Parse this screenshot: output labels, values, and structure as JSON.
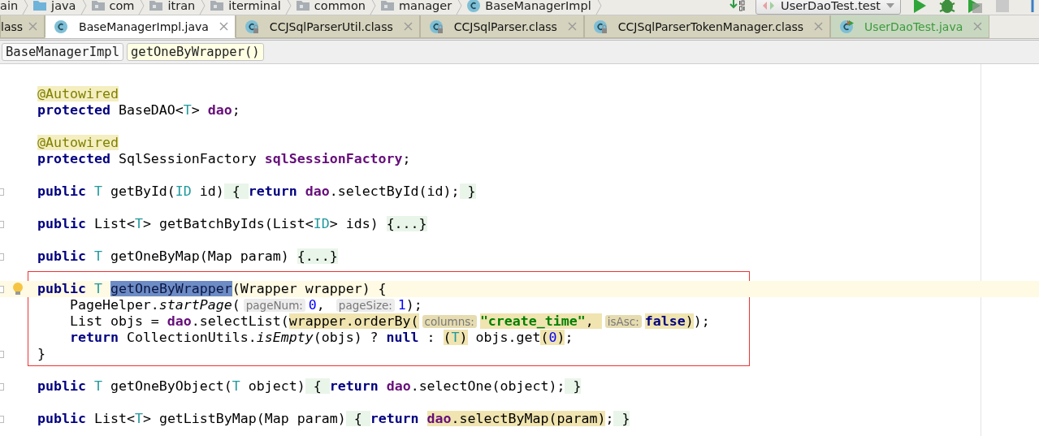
{
  "breadcrumbs": [
    {
      "label": "ain"
    },
    {
      "label": "java"
    },
    {
      "label": "com"
    },
    {
      "label": "itran"
    },
    {
      "label": "iterminal"
    },
    {
      "label": "common"
    },
    {
      "label": "manager"
    },
    {
      "label": "BaseManagerImpl"
    }
  ],
  "toolbar": {
    "run_config": "UserDaoTest.test"
  },
  "tabs": [
    {
      "label": "lass",
      "kind": "normal",
      "selected": false
    },
    {
      "label": "BaseManagerImpl.java",
      "kind": "normal",
      "selected": true
    },
    {
      "label": "CCJSqlParserUtil.class",
      "kind": "normal",
      "selected": false
    },
    {
      "label": "CCJSqlParser.class",
      "kind": "normal",
      "selected": false
    },
    {
      "label": "CCJSqlParserTokenManager.class",
      "kind": "normal",
      "selected": false
    },
    {
      "label": "UserDaoTest.java",
      "kind": "test",
      "selected": false
    }
  ],
  "structure": [
    {
      "label": "BaseManagerImpl",
      "selected": false
    },
    {
      "label": "getOneByWrapper()",
      "selected": true
    }
  ],
  "editor": {
    "blocks": [
      {
        "framed": false,
        "lines": [
          {
            "fold": false,
            "current": false,
            "intention": false,
            "tokens": [
              {
                "text": "@Autowired",
                "kind": "annotation"
              }
            ]
          },
          {
            "fold": false,
            "current": false,
            "intention": false,
            "tokens": [
              {
                "text": "protected",
                "kind": "keyword"
              },
              {
                "text": " BaseDAO<",
                "kind": "plain"
              },
              {
                "text": "T",
                "kind": "typeparam"
              },
              {
                "text": "> ",
                "kind": "plain"
              },
              {
                "text": "dao",
                "kind": "field"
              },
              {
                "text": ";",
                "kind": "plain"
              }
            ]
          },
          {
            "fold": false,
            "current": false,
            "intention": false
          },
          {
            "fold": false,
            "current": false,
            "intention": false,
            "tokens": [
              {
                "text": "@Autowired",
                "kind": "annotation"
              }
            ]
          },
          {
            "fold": false,
            "current": false,
            "intention": false,
            "tokens": [
              {
                "text": "protected",
                "kind": "keyword"
              },
              {
                "text": " SqlSessionFactory ",
                "kind": "plain"
              },
              {
                "text": "sqlSessionFactory",
                "kind": "field"
              },
              {
                "text": ";",
                "kind": "plain"
              }
            ]
          },
          {
            "fold": false,
            "current": false,
            "intention": false
          },
          {
            "fold": true,
            "current": false,
            "intention": false,
            "tokens": [
              {
                "text": "public",
                "kind": "keyword"
              },
              {
                "text": " T",
                "kind": "typeparam"
              },
              {
                "text": " getById(",
                "kind": "plain"
              },
              {
                "text": "ID",
                "kind": "typeparam"
              },
              {
                "text": " id)",
                "kind": "plain"
              },
              {
                "text": " { ",
                "kind": "fold"
              },
              {
                "text": "return",
                "kind": "keyword"
              },
              {
                "text": " dao",
                "kind": "field"
              },
              {
                "text": ".selectById(id);",
                "kind": "plain"
              },
              {
                "text": " }",
                "kind": "fold"
              }
            ]
          },
          {
            "fold": false,
            "current": false,
            "intention": false
          },
          {
            "fold": true,
            "current": false,
            "intention": false,
            "tokens": [
              {
                "text": "public",
                "kind": "keyword"
              },
              {
                "text": " List<",
                "kind": "plain"
              },
              {
                "text": "T",
                "kind": "typeparam"
              },
              {
                "text": "> getBatchByIds(List<",
                "kind": "plain"
              },
              {
                "text": "ID",
                "kind": "typeparam"
              },
              {
                "text": "> ids) ",
                "kind": "plain"
              },
              {
                "text": "{...}",
                "kind": "fold"
              }
            ]
          },
          {
            "fold": false,
            "current": false,
            "intention": false
          },
          {
            "fold": true,
            "current": false,
            "intention": false,
            "tokens": [
              {
                "text": "public",
                "kind": "keyword"
              },
              {
                "text": " T",
                "kind": "typeparam"
              },
              {
                "text": " getOneByMap(Map param) ",
                "kind": "plain"
              },
              {
                "text": "{...}",
                "kind": "fold"
              }
            ]
          },
          {
            "fold": false,
            "current": false,
            "intention": false
          }
        ]
      },
      {
        "framed": true,
        "lines": [
          {
            "fold": true,
            "current": true,
            "intention": true,
            "tokens": [
              {
                "text": "public",
                "kind": "keyword"
              },
              {
                "text": " T ",
                "kind": "typeparam"
              },
              {
                "text": "getOneByWrapper",
                "kind": "selection"
              },
              {
                "text": "(Wrapper wrapper) {",
                "kind": "plain"
              }
            ]
          },
          {
            "fold": false,
            "current": false,
            "intention": false,
            "tokens": [
              {
                "text": "    PageHelper.",
                "kind": "plain"
              },
              {
                "text": "startPage",
                "kind": "static"
              },
              {
                "text": "(",
                "kind": "plain"
              },
              {
                "text": "pageNum:",
                "kind": "hint"
              },
              {
                "text": "0",
                "kind": "number"
              },
              {
                "text": ", ",
                "kind": "plain"
              },
              {
                "text": "pageSize:",
                "kind": "hint"
              },
              {
                "text": "1",
                "kind": "number"
              },
              {
                "text": ");",
                "kind": "plain"
              }
            ]
          },
          {
            "fold": false,
            "current": false,
            "intention": false,
            "tokens": [
              {
                "text": "    List objs = ",
                "kind": "plain"
              },
              {
                "text": "dao",
                "kind": "field"
              },
              {
                "text": ".selectList(",
                "kind": "plain"
              },
              {
                "text": "wrapper.orderBy(",
                "kind": "match"
              },
              {
                "text": "columns:",
                "kind": "match-hint"
              },
              {
                "text": "\"create_time\"",
                "kind": "match-string"
              },
              {
                "text": ", ",
                "kind": "match"
              },
              {
                "text": "isAsc:",
                "kind": "match-hint"
              },
              {
                "text": "false",
                "kind": "match-keyword"
              },
              {
                "text": ")",
                "kind": "match"
              },
              {
                "text": ");",
                "kind": "plain"
              }
            ]
          },
          {
            "fold": false,
            "current": false,
            "intention": false,
            "tokens": [
              {
                "text": "    return",
                "kind": "keyword"
              },
              {
                "text": " CollectionUtils.",
                "kind": "plain"
              },
              {
                "text": "isEmpty",
                "kind": "static"
              },
              {
                "text": "(objs) ? ",
                "kind": "plain"
              },
              {
                "text": "null",
                "kind": "keyword"
              },
              {
                "text": " : ",
                "kind": "plain"
              },
              {
                "text": "(",
                "kind": "match"
              },
              {
                "text": "T",
                "kind": "match-typeparam"
              },
              {
                "text": ")",
                "kind": "match"
              },
              {
                "text": " objs.get",
                "kind": "plain"
              },
              {
                "text": "(",
                "kind": "match"
              },
              {
                "text": "0",
                "kind": "match-number"
              },
              {
                "text": ")",
                "kind": "match"
              },
              {
                "text": ";",
                "kind": "plain"
              }
            ]
          },
          {
            "fold": true,
            "current": false,
            "intention": false,
            "tokens": [
              {
                "text": "}",
                "kind": "plain"
              }
            ]
          }
        ]
      },
      {
        "framed": false,
        "lines": [
          {
            "fold": false,
            "current": false,
            "intention": false
          },
          {
            "fold": true,
            "current": false,
            "intention": false,
            "tokens": [
              {
                "text": "public",
                "kind": "keyword"
              },
              {
                "text": " T",
                "kind": "typeparam"
              },
              {
                "text": " getOneByObject(",
                "kind": "plain"
              },
              {
                "text": "T",
                "kind": "typeparam"
              },
              {
                "text": " object)",
                "kind": "plain"
              },
              {
                "text": " { ",
                "kind": "fold"
              },
              {
                "text": "return",
                "kind": "keyword"
              },
              {
                "text": " dao",
                "kind": "field"
              },
              {
                "text": ".selectOne(object);",
                "kind": "plain"
              },
              {
                "text": " }",
                "kind": "fold"
              }
            ]
          },
          {
            "fold": false,
            "current": false,
            "intention": false
          },
          {
            "fold": true,
            "current": false,
            "intention": false,
            "tokens": [
              {
                "text": "public",
                "kind": "keyword"
              },
              {
                "text": " List<",
                "kind": "plain"
              },
              {
                "text": "T",
                "kind": "typeparam"
              },
              {
                "text": "> getListByMap(Map param)",
                "kind": "plain"
              },
              {
                "text": " { ",
                "kind": "fold"
              },
              {
                "text": "return ",
                "kind": "keyword"
              },
              {
                "text": "dao",
                "kind": "match-field"
              },
              {
                "text": ".selectByMap(param)",
                "kind": "match"
              },
              {
                "text": ";",
                "kind": "plain"
              },
              {
                "text": " }",
                "kind": "fold"
              }
            ]
          }
        ]
      }
    ]
  }
}
